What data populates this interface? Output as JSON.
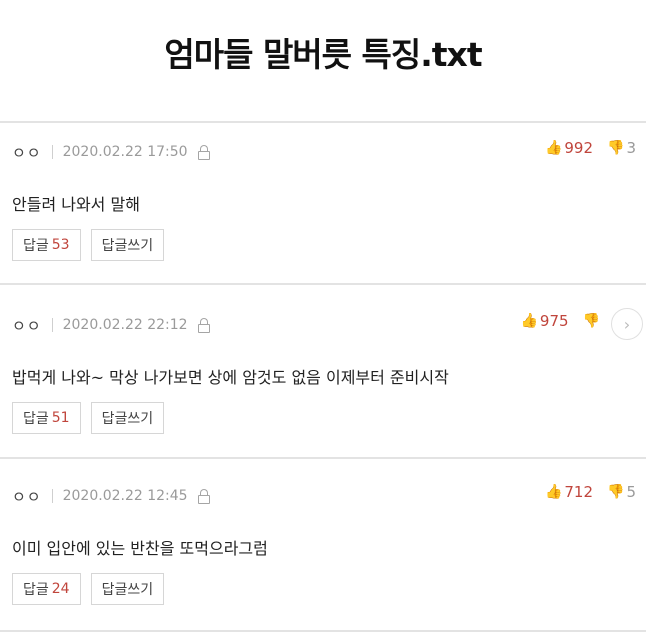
{
  "title": "엄마들 말버릇 특징.txt",
  "comments": [
    {
      "nickname": "ㅇㅇ",
      "date": "2020.02.22 17:50",
      "upvotes": "992",
      "downvotes": "3",
      "text": "안들려 나와서 말해",
      "reply_label": "답글",
      "reply_count": "53",
      "write_reply_label": "답글쓰기"
    },
    {
      "nickname": "ㅇㅇ",
      "date": "2020.02.22 22:12",
      "upvotes": "975",
      "downvotes": "",
      "text": "밥먹게 나와~ 막상 나가보면 상에 암것도 없음 이제부터 준비시작",
      "reply_label": "답글",
      "reply_count": "51",
      "write_reply_label": "답글쓰기"
    },
    {
      "nickname": "ㅇㅇ",
      "date": "2020.02.22 12:45",
      "upvotes": "712",
      "downvotes": "5",
      "text": "이미 입안에 있는 반찬을 또먹으라그럼",
      "reply_label": "답글",
      "reply_count": "24",
      "write_reply_label": "답글쓰기"
    }
  ],
  "icons": {
    "upvote": "thumbs-up-icon",
    "downvote": "thumbs-down-icon",
    "lock": "lock-icon",
    "scroll": "chevron-right-icon"
  },
  "colors": {
    "accent": "#c0453c",
    "muted": "#9a9a9a",
    "divider": "#e3e3e3"
  }
}
